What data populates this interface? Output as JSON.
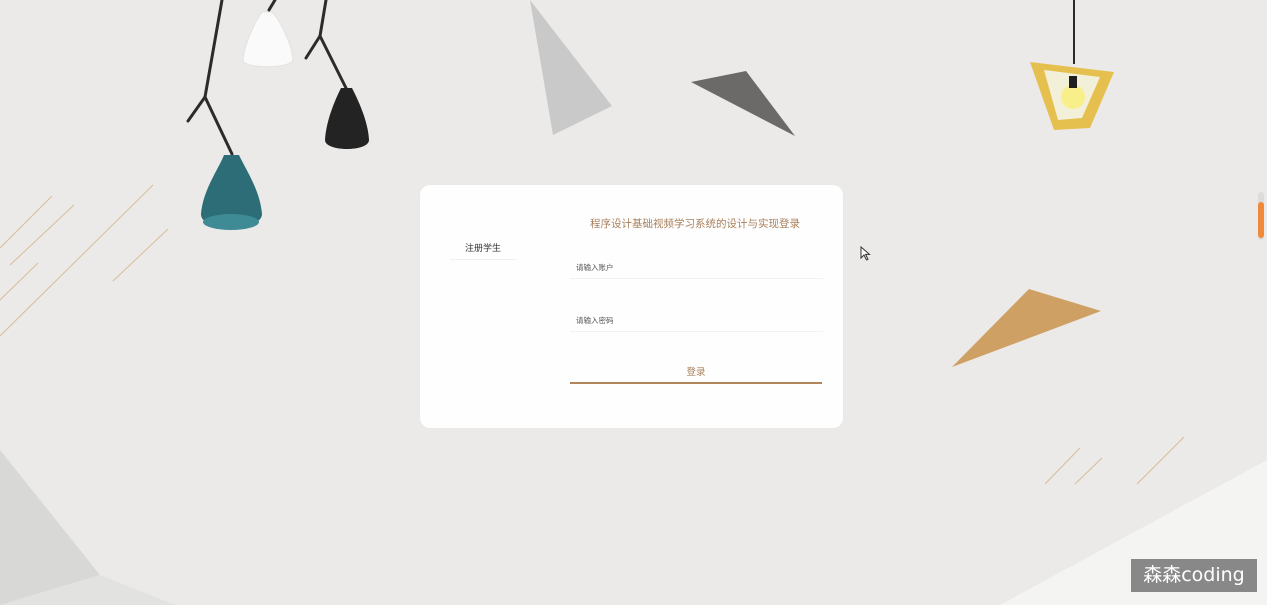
{
  "login_card": {
    "title": "程序设计基础视频学习系统的设计与实现登录",
    "register_link": "注册学生",
    "account_placeholder": "请输入账户",
    "password_placeholder": "请输入密码",
    "login_button": "登录"
  },
  "overlay": {
    "watermark": "森森coding"
  },
  "colors": {
    "accent": "#a8805a",
    "background": "#ebeae8",
    "card": "#fefeff",
    "scroll_indicator": "#f08a3a"
  },
  "icons": {
    "cursor": "mouse-pointer-icon"
  }
}
